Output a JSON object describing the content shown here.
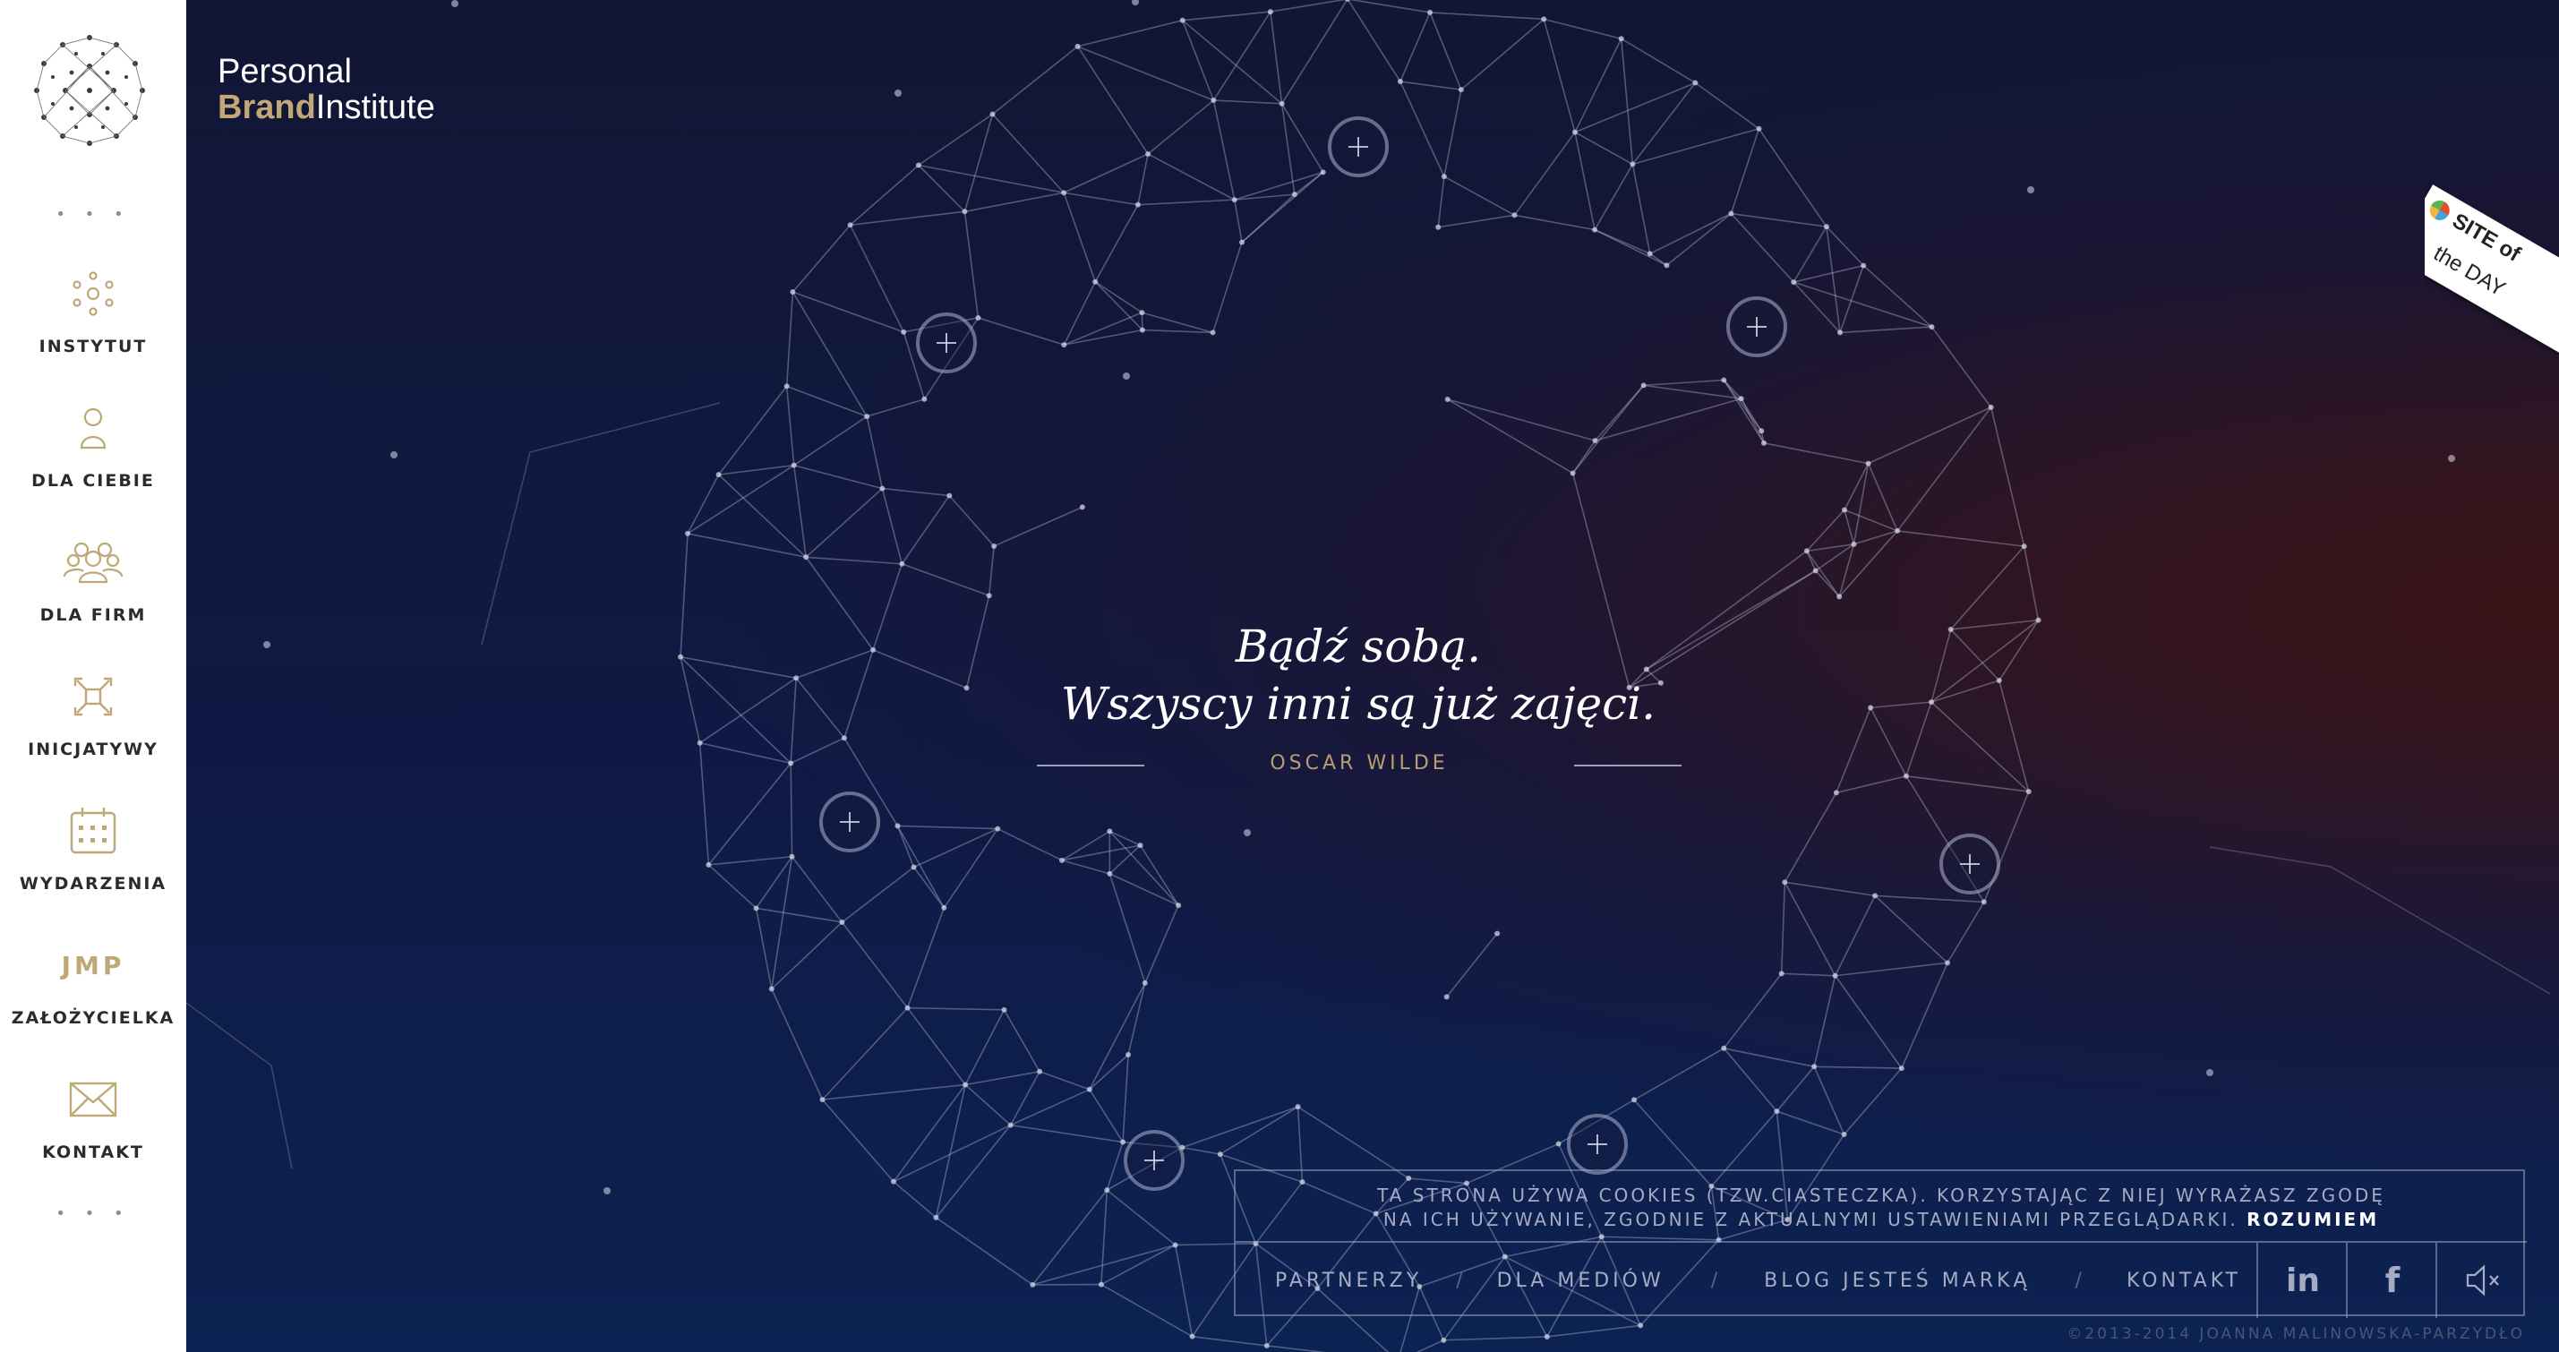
{
  "sidebar": {
    "top_dots": "• • •",
    "bottom_dots": "• • •",
    "items": [
      {
        "label": "INSTYTUT",
        "icon": "instytut-icon"
      },
      {
        "label": "DLA CIEBIE",
        "icon": "person-icon"
      },
      {
        "label": "DLA FIRM",
        "icon": "group-icon"
      },
      {
        "label": "INICJATYWY",
        "icon": "initiatives-icon"
      },
      {
        "label": "WYDARZENIA",
        "icon": "calendar-icon"
      },
      {
        "label": "ZAŁOŻYCIELKA",
        "icon": "jmp-monogram-icon",
        "monogram": "JMP"
      },
      {
        "label": "KONTAKT",
        "icon": "envelope-icon"
      }
    ]
  },
  "brand": {
    "line1": "Personal",
    "line2_gold": "Brand",
    "line2_white": "Institute"
  },
  "quote": {
    "line1": "Bądź sobą.",
    "line2": "Wszyscy inni są już zajęci.",
    "author": "OSCAR WILDE"
  },
  "ribbon": {
    "site": "SITE of",
    "day": "the DAY"
  },
  "cookie": {
    "text_line1": "TA STRONA UŻYWA COOKIES (TZW.CIASTECZKA). KORZYSTAJĄC Z NIEJ WYRAŻASZ ZGODĘ",
    "text_line2": "NA ICH UŻYWANIE, ZGODNIE Z AKTUALNYMI USTAWIENIAMI PRZEGLĄDARKI.",
    "accept": "ROZUMIEM"
  },
  "footer": {
    "links": [
      "PARTNERZY",
      "DLA MEDIÓW",
      "BLOG JESTEŚ MARKĄ",
      "KONTAKT"
    ],
    "separator": "/",
    "social": [
      "linkedin-icon",
      "facebook-icon",
      "sound-muted-icon"
    ],
    "linkedin_text": "in",
    "facebook_text": "f",
    "copyright": "©2013-2014 JOANNA MALINOWSKA-PARZYDŁO"
  },
  "colors": {
    "gold": "#c2a877",
    "sidebar_bg": "#ffffff",
    "stage_dark_blue": "#0f1a44",
    "stage_red": "#3a1418"
  }
}
